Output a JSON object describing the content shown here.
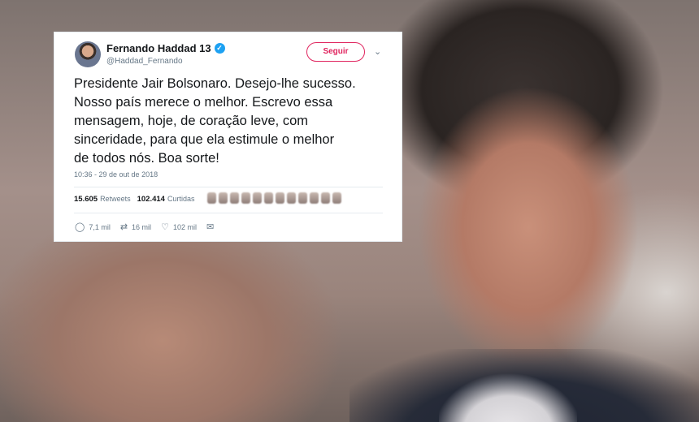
{
  "tweet": {
    "author_name": "Fernando Haddad 13",
    "handle": "@Haddad_Fernando",
    "follow_label": "Seguir",
    "text": "Presidente Jair Bolsonaro. Desejo-lhe sucesso.\nNosso país merece o melhor. Escrevo essa\nmensagem, hoje, de coração leve,  com\nsinceridade, para que ela estimule o melhor\nde todos nós. Boa sorte!",
    "timestamp": "10:36 - 29 de out de 2018",
    "retweets_count": "15.605",
    "retweets_label": "Retweets",
    "likes_count": "102.414",
    "likes_label": "Curtidas",
    "actions": {
      "reply_count": "7,1 mil",
      "retweet_count": "16 mil",
      "like_count": "102 mil"
    },
    "icons": {
      "verified": "verified-badge-icon",
      "chevron": "chevron-down-icon",
      "reply": "reply-icon",
      "retweet": "retweet-icon",
      "like": "heart-icon",
      "message": "envelope-icon"
    },
    "colors": {
      "follow": "#e0245e",
      "verified": "#1da1f2",
      "text": "#14171a",
      "muted": "#657786"
    }
  }
}
